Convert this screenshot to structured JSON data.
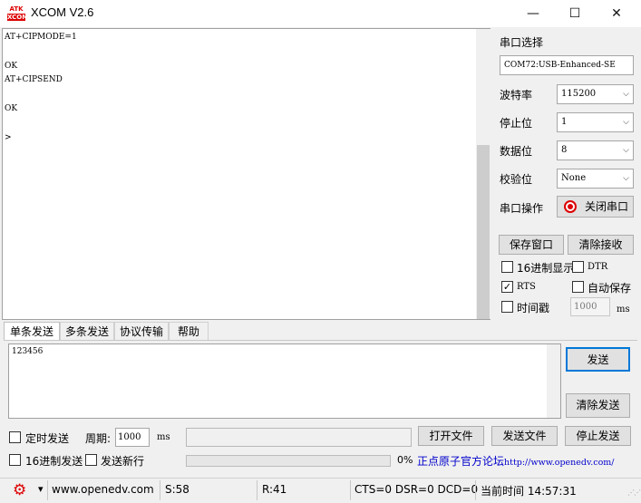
{
  "window": {
    "logo_line1": "ATK",
    "logo_line2": "XCOM",
    "title": "XCOM V2.6",
    "controls": {
      "minimize": "—",
      "maximize": "☐",
      "close": "✕"
    }
  },
  "receive": {
    "text": "AT+CIPMODE=1\n\nOK\nAT+CIPSEND\n\nOK\n\n>"
  },
  "panel": {
    "port_select_label": "串口选择",
    "port_value": "COM72:USB-Enhanced-SE",
    "baud_label": "波特率",
    "baud_value": "115200",
    "stopbits_label": "停止位",
    "stopbits_value": "1",
    "databits_label": "数据位",
    "databits_value": "8",
    "parity_label": "校验位",
    "parity_value": "None",
    "port_op_label": "串口操作",
    "close_port_button": "关闭串口",
    "save_window_button": "保存窗口",
    "clear_receive_button": "清除接收",
    "hex_display_label": "16进制显示",
    "dtr_label": "DTR",
    "rts_label": "RTS",
    "auto_save_label": "自动保存",
    "timestamp_label": "时间戳",
    "timestamp_ms_value": "1000",
    "ms_label": "ms",
    "checked_mark": "✓",
    "combo_arrow": "⌵"
  },
  "tabs": [
    "单条发送",
    "多条发送",
    "协议传输",
    "帮助"
  ],
  "send": {
    "text": "123456",
    "send_button": "发送",
    "clear_send_button": "清除发送",
    "timed_send_label": "定时发送",
    "period_label": "周期:",
    "period_value": "1000",
    "ms_label": "ms",
    "open_file_button": "打开文件",
    "send_file_button": "发送文件",
    "stop_send_button": "停止发送",
    "hex_send_label": "16进制发送",
    "send_newline_label": "发送新行",
    "progress_percent_label": "0%",
    "progress": 0,
    "link_prefix": "正点原子官方论坛",
    "link_url": "http://www.openedv.com/"
  },
  "status": {
    "gear_icon": "⚙",
    "dropdown": "▾",
    "site": "www.openedv.com",
    "sent": "S:58",
    "received": "R:41",
    "lines": "CTS=0 DSR=0 DCD=0",
    "time": "当前时间 14:57:31"
  },
  "colors": {
    "accent_red": "#dd0000",
    "link_blue": "#0000cc",
    "send_button_border": "#0078d7"
  }
}
